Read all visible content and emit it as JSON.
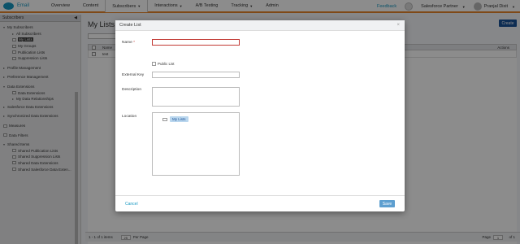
{
  "nav": {
    "app_name": "Email",
    "tabs": [
      "Overview",
      "Content",
      "Subscribers",
      "Interactions",
      "A/B Testing",
      "Tracking",
      "Admin"
    ],
    "feedback": "Feedback",
    "partner": "Salesforce Partner",
    "user": "Pranjal Dixit"
  },
  "sidebar": {
    "title": "Subscribers",
    "items": [
      {
        "label": "My Subscribers"
      },
      {
        "label": "All Subscribers"
      },
      {
        "label": "My Lists"
      },
      {
        "label": "My Groups"
      },
      {
        "label": "Publication Lists"
      },
      {
        "label": "Suppression Lists"
      },
      {
        "label": "Profile Management"
      },
      {
        "label": "Preference Management"
      },
      {
        "label": "Data Extensions"
      },
      {
        "label": "Data Extensions"
      },
      {
        "label": "My Data Relationships"
      },
      {
        "label": "Salesforce Data Extensions"
      },
      {
        "label": "Synchronized Data Extensions"
      },
      {
        "label": "Measures"
      },
      {
        "label": "Data Filters"
      },
      {
        "label": "Shared Items"
      },
      {
        "label": "Shared Publication Lists"
      },
      {
        "label": "Shared Suppression Lists"
      },
      {
        "label": "Shared Data Extensions"
      },
      {
        "label": "Shared Salesforce Data Exten..."
      }
    ]
  },
  "main": {
    "title": "My Lists",
    "create_label": "Create",
    "col_name": "Name",
    "col_actions": "Actions",
    "row_name": "test",
    "footer_items": "1 - 1 of 1 items",
    "footer_per_page_val": "25",
    "footer_per_page": "Per Page",
    "footer_page": "Page",
    "footer_page_val": "1",
    "footer_of": "of 1"
  },
  "modal": {
    "title": "Create List",
    "name_label": "Name",
    "required_mark": "*",
    "public_label": "Public List",
    "external_key_label": "External Key",
    "description_label": "Description",
    "location_label": "Location",
    "location_value": "My Lists",
    "cancel_label": "Cancel",
    "save_label": "Save"
  }
}
